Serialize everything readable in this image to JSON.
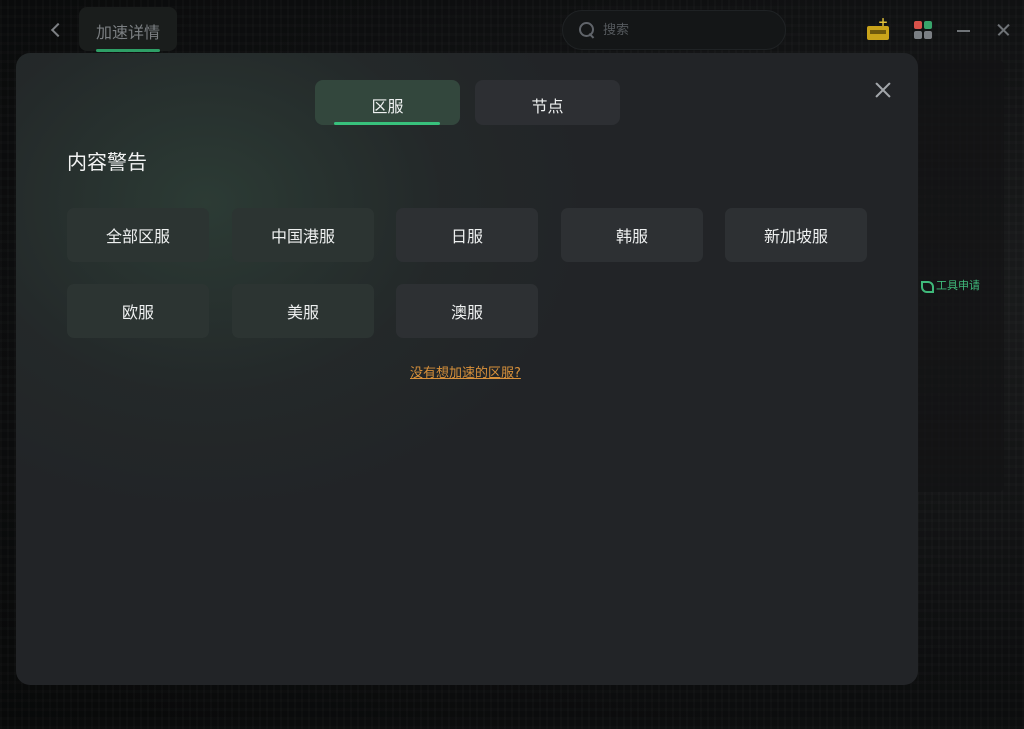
{
  "topbar": {
    "back_icon": "chevron-left-icon",
    "title": "加速详情",
    "search_placeholder": "搜索",
    "icons": [
      "gift-icon",
      "apps-icon",
      "minimize-icon",
      "close-icon"
    ]
  },
  "background": {
    "tool_label": "工具申请"
  },
  "modal": {
    "tabs": [
      {
        "label": "区服",
        "active": true
      },
      {
        "label": "节点",
        "active": false
      }
    ],
    "section_title": "内容警告",
    "regions": [
      "全部区服",
      "中国港服",
      "日服",
      "韩服",
      "新加坡服",
      "欧服",
      "美服",
      "澳服"
    ],
    "missing_link": "没有想加速的区服?"
  },
  "colors": {
    "accent_green": "#38c17c",
    "link_orange": "#d8913b",
    "modal_bg": "#222427"
  }
}
